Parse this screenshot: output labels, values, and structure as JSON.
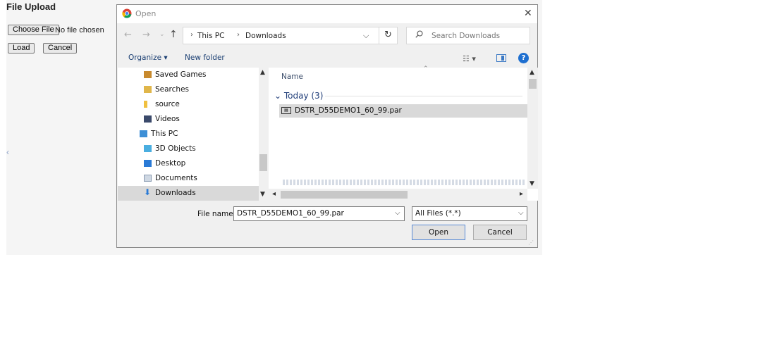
{
  "web": {
    "title": "File Upload",
    "choose_file": "Choose File",
    "no_file": "No file chosen",
    "load": "Load",
    "cancel": "Cancel"
  },
  "dialog": {
    "title": "Open",
    "address": {
      "crumbs": [
        "This PC",
        "Downloads"
      ]
    },
    "search_placeholder": "Search Downloads",
    "toolbar": {
      "organize": "Organize ▾",
      "new_folder": "New folder"
    },
    "nav_items": [
      {
        "label": "Saved Games",
        "icon": "saved-games-icon"
      },
      {
        "label": "Searches",
        "icon": "searches-icon"
      },
      {
        "label": "source",
        "icon": "folder-icon"
      },
      {
        "label": "Videos",
        "icon": "videos-icon"
      },
      {
        "label": "This PC",
        "icon": "computer-icon"
      },
      {
        "label": "3D Objects",
        "icon": "3d-objects-icon"
      },
      {
        "label": "Desktop",
        "icon": "desktop-icon"
      },
      {
        "label": "Documents",
        "icon": "documents-icon"
      },
      {
        "label": "Downloads",
        "icon": "downloads-icon"
      }
    ],
    "file_list": {
      "column_name": "Name",
      "group": "Today (3)",
      "files": [
        "DSTR_D55DEMO1_60_99.par"
      ]
    },
    "file_name_label": "File name:",
    "file_name_value": "DSTR_D55DEMO1_60_99.par",
    "filter_value": "All Files (*.*)",
    "open_button": "Open",
    "cancel_button": "Cancel",
    "colors": {
      "accent": "#1e6fd0",
      "selection": "#d9d9d9",
      "group_text": "#1e3c78"
    }
  }
}
